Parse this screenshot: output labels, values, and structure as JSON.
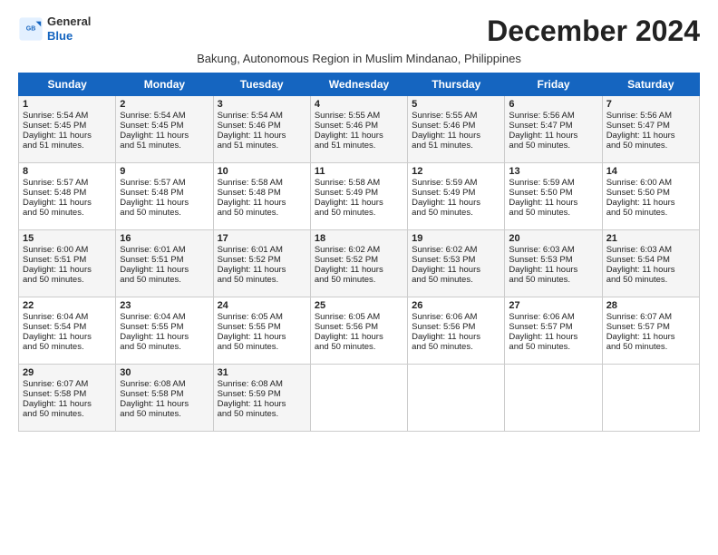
{
  "header": {
    "logo_line1": "General",
    "logo_line2": "Blue",
    "month_title": "December 2024",
    "subtitle": "Bakung, Autonomous Region in Muslim Mindanao, Philippines"
  },
  "days_of_week": [
    "Sunday",
    "Monday",
    "Tuesday",
    "Wednesday",
    "Thursday",
    "Friday",
    "Saturday"
  ],
  "weeks": [
    [
      {
        "day": 1,
        "info": "Sunrise: 5:54 AM\nSunset: 5:45 PM\nDaylight: 11 hours\nand 51 minutes."
      },
      {
        "day": 2,
        "info": "Sunrise: 5:54 AM\nSunset: 5:45 PM\nDaylight: 11 hours\nand 51 minutes."
      },
      {
        "day": 3,
        "info": "Sunrise: 5:54 AM\nSunset: 5:46 PM\nDaylight: 11 hours\nand 51 minutes."
      },
      {
        "day": 4,
        "info": "Sunrise: 5:55 AM\nSunset: 5:46 PM\nDaylight: 11 hours\nand 51 minutes."
      },
      {
        "day": 5,
        "info": "Sunrise: 5:55 AM\nSunset: 5:46 PM\nDaylight: 11 hours\nand 51 minutes."
      },
      {
        "day": 6,
        "info": "Sunrise: 5:56 AM\nSunset: 5:47 PM\nDaylight: 11 hours\nand 50 minutes."
      },
      {
        "day": 7,
        "info": "Sunrise: 5:56 AM\nSunset: 5:47 PM\nDaylight: 11 hours\nand 50 minutes."
      }
    ],
    [
      {
        "day": 8,
        "info": "Sunrise: 5:57 AM\nSunset: 5:48 PM\nDaylight: 11 hours\nand 50 minutes."
      },
      {
        "day": 9,
        "info": "Sunrise: 5:57 AM\nSunset: 5:48 PM\nDaylight: 11 hours\nand 50 minutes."
      },
      {
        "day": 10,
        "info": "Sunrise: 5:58 AM\nSunset: 5:48 PM\nDaylight: 11 hours\nand 50 minutes."
      },
      {
        "day": 11,
        "info": "Sunrise: 5:58 AM\nSunset: 5:49 PM\nDaylight: 11 hours\nand 50 minutes."
      },
      {
        "day": 12,
        "info": "Sunrise: 5:59 AM\nSunset: 5:49 PM\nDaylight: 11 hours\nand 50 minutes."
      },
      {
        "day": 13,
        "info": "Sunrise: 5:59 AM\nSunset: 5:50 PM\nDaylight: 11 hours\nand 50 minutes."
      },
      {
        "day": 14,
        "info": "Sunrise: 6:00 AM\nSunset: 5:50 PM\nDaylight: 11 hours\nand 50 minutes."
      }
    ],
    [
      {
        "day": 15,
        "info": "Sunrise: 6:00 AM\nSunset: 5:51 PM\nDaylight: 11 hours\nand 50 minutes."
      },
      {
        "day": 16,
        "info": "Sunrise: 6:01 AM\nSunset: 5:51 PM\nDaylight: 11 hours\nand 50 minutes."
      },
      {
        "day": 17,
        "info": "Sunrise: 6:01 AM\nSunset: 5:52 PM\nDaylight: 11 hours\nand 50 minutes."
      },
      {
        "day": 18,
        "info": "Sunrise: 6:02 AM\nSunset: 5:52 PM\nDaylight: 11 hours\nand 50 minutes."
      },
      {
        "day": 19,
        "info": "Sunrise: 6:02 AM\nSunset: 5:53 PM\nDaylight: 11 hours\nand 50 minutes."
      },
      {
        "day": 20,
        "info": "Sunrise: 6:03 AM\nSunset: 5:53 PM\nDaylight: 11 hours\nand 50 minutes."
      },
      {
        "day": 21,
        "info": "Sunrise: 6:03 AM\nSunset: 5:54 PM\nDaylight: 11 hours\nand 50 minutes."
      }
    ],
    [
      {
        "day": 22,
        "info": "Sunrise: 6:04 AM\nSunset: 5:54 PM\nDaylight: 11 hours\nand 50 minutes."
      },
      {
        "day": 23,
        "info": "Sunrise: 6:04 AM\nSunset: 5:55 PM\nDaylight: 11 hours\nand 50 minutes."
      },
      {
        "day": 24,
        "info": "Sunrise: 6:05 AM\nSunset: 5:55 PM\nDaylight: 11 hours\nand 50 minutes."
      },
      {
        "day": 25,
        "info": "Sunrise: 6:05 AM\nSunset: 5:56 PM\nDaylight: 11 hours\nand 50 minutes."
      },
      {
        "day": 26,
        "info": "Sunrise: 6:06 AM\nSunset: 5:56 PM\nDaylight: 11 hours\nand 50 minutes."
      },
      {
        "day": 27,
        "info": "Sunrise: 6:06 AM\nSunset: 5:57 PM\nDaylight: 11 hours\nand 50 minutes."
      },
      {
        "day": 28,
        "info": "Sunrise: 6:07 AM\nSunset: 5:57 PM\nDaylight: 11 hours\nand 50 minutes."
      }
    ],
    [
      {
        "day": 29,
        "info": "Sunrise: 6:07 AM\nSunset: 5:58 PM\nDaylight: 11 hours\nand 50 minutes."
      },
      {
        "day": 30,
        "info": "Sunrise: 6:08 AM\nSunset: 5:58 PM\nDaylight: 11 hours\nand 50 minutes."
      },
      {
        "day": 31,
        "info": "Sunrise: 6:08 AM\nSunset: 5:59 PM\nDaylight: 11 hours\nand 50 minutes."
      },
      null,
      null,
      null,
      null
    ]
  ]
}
